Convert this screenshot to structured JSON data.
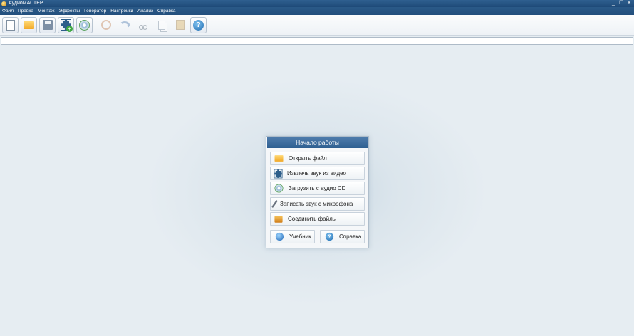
{
  "window": {
    "title": "АудиоМАСТЕР",
    "controls": [
      "_",
      "❐",
      "✕"
    ]
  },
  "menu": [
    "Файл",
    "Правка",
    "Монтаж",
    "Эффекты",
    "Генератор",
    "Настройки",
    "Анализ",
    "Справка"
  ],
  "toolbar": {
    "buttons": [
      {
        "icon": "new-document-icon",
        "enabled": true
      },
      {
        "icon": "open-folder-icon",
        "enabled": true
      },
      {
        "icon": "save-icon",
        "enabled": true
      },
      {
        "icon": "extract-from-video-icon",
        "enabled": true
      },
      {
        "icon": "load-cd-icon",
        "enabled": true
      },
      {
        "icon": "select-icon",
        "enabled": false
      },
      {
        "icon": "undo-icon",
        "enabled": false
      },
      {
        "icon": "cut-icon",
        "enabled": false
      },
      {
        "icon": "copy-icon",
        "enabled": false
      },
      {
        "icon": "paste-icon",
        "enabled": false
      },
      {
        "icon": "help-icon",
        "enabled": true
      }
    ]
  },
  "start_panel": {
    "title": "Начало работы",
    "actions": [
      {
        "label": "Открыть файл",
        "icon": "folder-icon"
      },
      {
        "label": "Извлечь звук из видео",
        "icon": "video-icon"
      },
      {
        "label": "Загрузить с аудио CD",
        "icon": "cd-icon"
      },
      {
        "label": "Записать звук с микрофона",
        "icon": "microphone-icon"
      },
      {
        "label": "Соединить файлы",
        "icon": "join-files-icon"
      }
    ],
    "tutorial_label": "Учебник",
    "help_label": "Справка"
  }
}
